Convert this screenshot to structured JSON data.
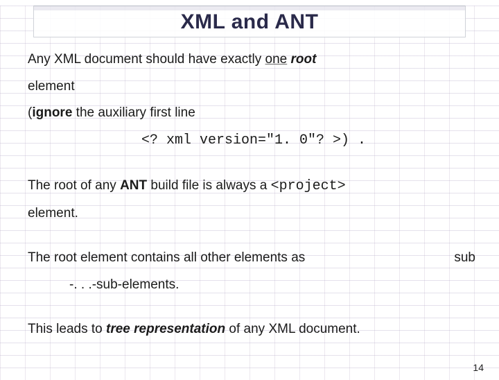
{
  "slide": {
    "title": "XML and ANT",
    "p1_a": "Any XML document should have exactly ",
    "p1_b": "one",
    "p1_c": " ",
    "p1_d": "root",
    "p2": "element",
    "p3_a": "(",
    "p3_b": "ignore",
    "p3_c": " the auxiliary first line",
    "code": "<? xml version=\"1. 0\"? >",
    "code_tail": ") .",
    "p4_a": "The root of any ",
    "p4_b": "ANT",
    "p4_c": " build file is always a ",
    "p4_code": "<project>",
    "p5": "element.",
    "p6_left": "The root element contains all other elements as",
    "p6_right": "sub",
    "p6_sub": "-. . .-sub-elements.",
    "p7_a": "This leads to ",
    "p7_b": "tree representation",
    "p7_c": "  of any XML document.",
    "pagenum": "14"
  }
}
